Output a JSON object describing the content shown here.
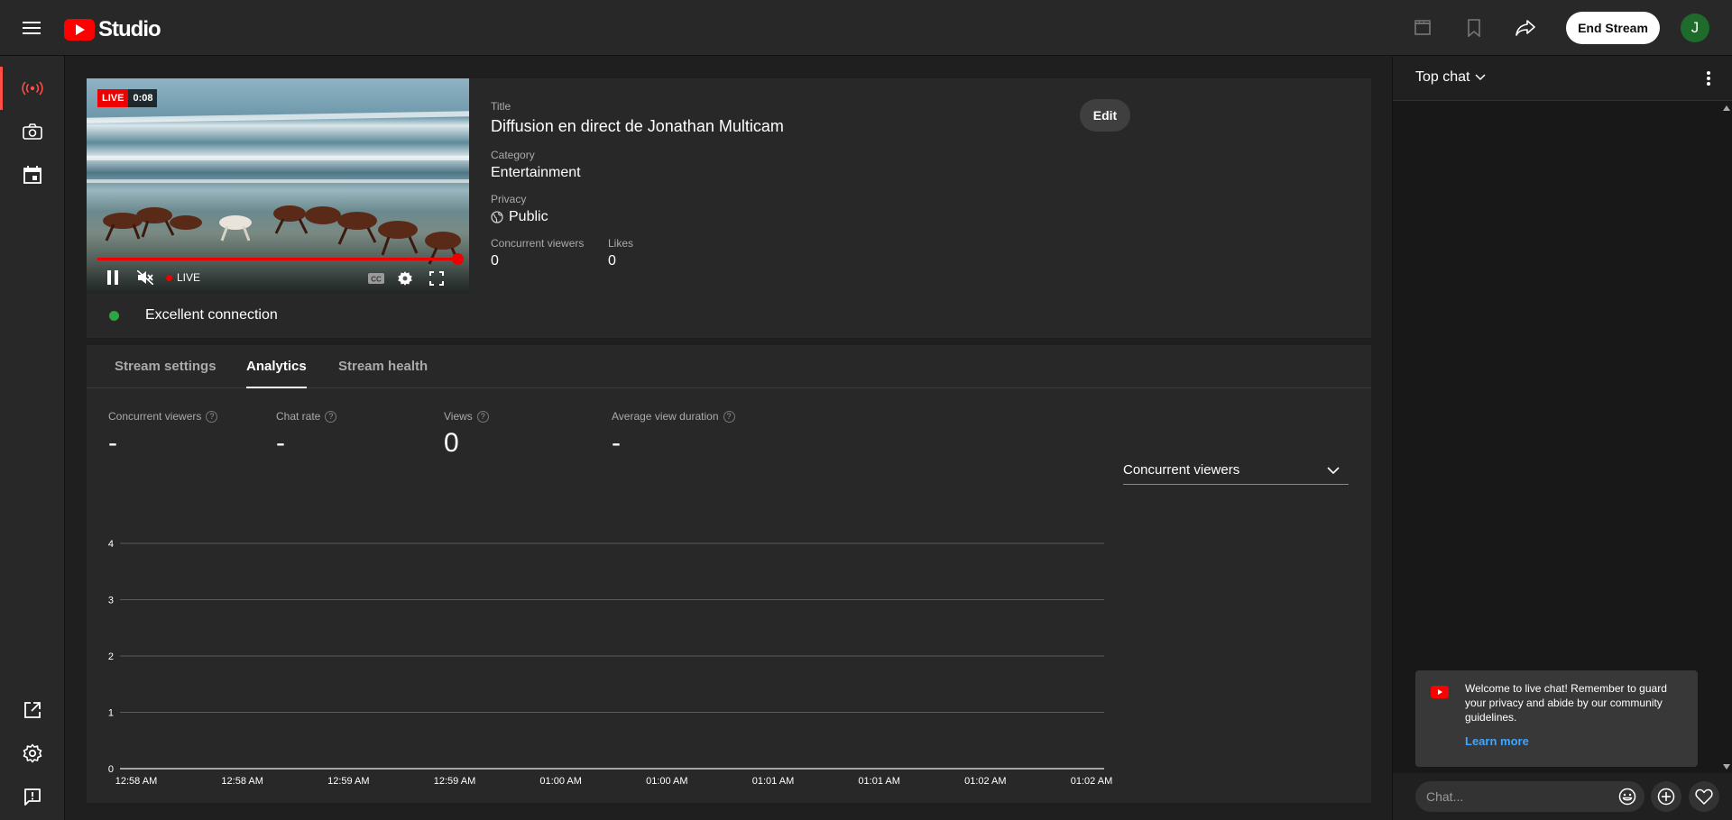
{
  "app": {
    "name": "Studio",
    "brand_color": "#ff0000"
  },
  "header": {
    "end_stream_label": "End Stream",
    "avatar_letter": "J",
    "avatar_color": "#1e6b2c"
  },
  "player": {
    "live_badge": "LIVE",
    "elapsed": "0:08",
    "live_indicator": "LIVE"
  },
  "stream_info": {
    "title_label": "Title",
    "title_value": "Diffusion en direct de Jonathan Multicam",
    "category_label": "Category",
    "category_value": "Entertainment",
    "privacy_label": "Privacy",
    "privacy_value": "Public",
    "concurrent_label": "Concurrent viewers",
    "concurrent_value": "0",
    "likes_label": "Likes",
    "likes_value": "0",
    "edit_label": "Edit"
  },
  "connection": {
    "status": "Excellent connection",
    "status_color": "#2ba640"
  },
  "tabs": [
    {
      "label": "Stream settings"
    },
    {
      "label": "Analytics"
    },
    {
      "label": "Stream health"
    }
  ],
  "metrics": [
    {
      "label": "Concurrent viewers",
      "value": "-"
    },
    {
      "label": "Chat rate",
      "value": "-"
    },
    {
      "label": "Views",
      "value": "0"
    },
    {
      "label": "Average view duration",
      "value": "-"
    }
  ],
  "chart_selector": {
    "selected": "Concurrent viewers"
  },
  "chart_data": {
    "type": "line",
    "x": [
      "12:58 AM",
      "12:58 AM",
      "12:59 AM",
      "12:59 AM",
      "01:00 AM",
      "01:00 AM",
      "01:01 AM",
      "01:01 AM",
      "01:02 AM",
      "01:02 AM"
    ],
    "y_ticks": [
      0,
      1,
      2,
      3,
      4
    ],
    "ylim": [
      0,
      4
    ],
    "grid": true,
    "series": [],
    "title": "",
    "xlabel": "",
    "ylabel": ""
  },
  "chat": {
    "mode_label": "Top chat",
    "welcome_text": "Welcome to live chat! Remember to guard your privacy and abide by our community guidelines.",
    "learn_more": "Learn more",
    "input_placeholder": "Chat..."
  }
}
